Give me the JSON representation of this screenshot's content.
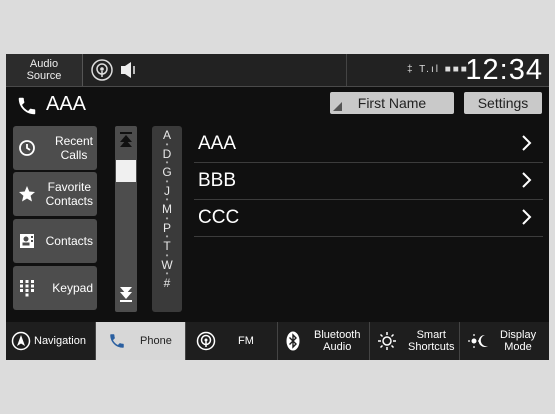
{
  "status_bar": {
    "audio_source": "Audio\nSource",
    "indicators": "‡ T.ıl ■■■",
    "clock": "12:34"
  },
  "header": {
    "caller": "AAA",
    "sort_button": "First Name",
    "settings_button": "Settings"
  },
  "menu": [
    {
      "label": "Recent\nCalls",
      "icon": "history-icon"
    },
    {
      "label": "Favorite\nContacts",
      "icon": "star-icon"
    },
    {
      "label": "Contacts",
      "icon": "contacts-card-icon"
    },
    {
      "label": "Keypad",
      "icon": "keypad-icon"
    }
  ],
  "alphabet": [
    "A",
    "D",
    "G",
    "J",
    "M",
    "P",
    "T",
    "W",
    "#"
  ],
  "contacts": [
    "AAA",
    "BBB",
    "CCC"
  ],
  "bottom_nav": [
    {
      "label": "Navigation",
      "icon": "navigation-icon"
    },
    {
      "label": "Phone",
      "icon": "phone-icon",
      "active": true
    },
    {
      "label": "FM",
      "icon": "radio-icon"
    },
    {
      "label": "Bluetooth\nAudio",
      "icon": "bluetooth-icon"
    },
    {
      "label": "Smart\nShortcuts",
      "icon": "smart-shortcuts-icon"
    },
    {
      "label": "Display\nMode",
      "icon": "display-mode-icon"
    }
  ],
  "colors": {
    "background": "#101010",
    "button": "#4d4d4d",
    "active_tab": "#d7d7d7"
  }
}
